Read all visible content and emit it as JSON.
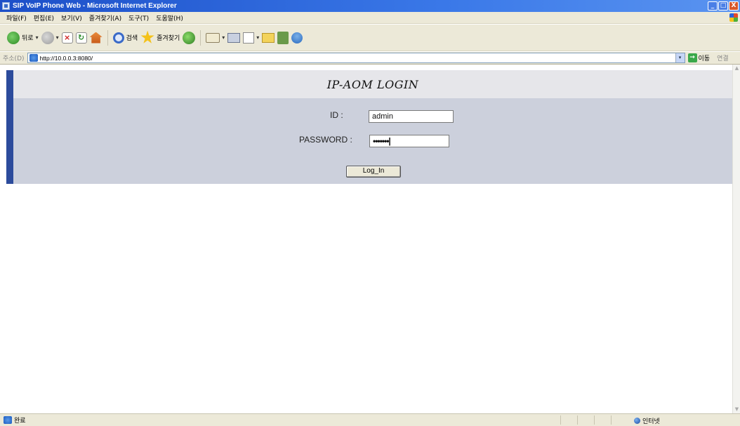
{
  "window": {
    "title": "SIP VoIP Phone Web - Microsoft Internet Explorer",
    "minimize": "_",
    "maximize": "□",
    "close": "X"
  },
  "menubar": [
    "파일(F)",
    "편집(E)",
    "보기(V)",
    "즐겨찾기(A)",
    "도구(T)",
    "도움말(H)"
  ],
  "toolbar": {
    "back_label": "뒤로",
    "search_label": "검색",
    "favorites_label": "즐겨찾기",
    "dropdown_glyph": "▾"
  },
  "address": {
    "label": "주소(D)",
    "url": "http://10.0.0.3:8080/",
    "go_label": "이동",
    "go_icon": "→",
    "links_label": "연결"
  },
  "page": {
    "title": "IP-AOM  LOGIN",
    "id_label": "ID :",
    "id_value": "admin",
    "password_label": "PASSWORD :",
    "password_value": "•••••••|",
    "login_button": "Log_In"
  },
  "status": {
    "text": "완료",
    "zone": "인터넷"
  },
  "colors": {
    "title_bar": "#1c4fc8",
    "left_accent": "#2c4b9c",
    "header_band": "#e6e6ea",
    "form_band": "#ccd0dc"
  }
}
